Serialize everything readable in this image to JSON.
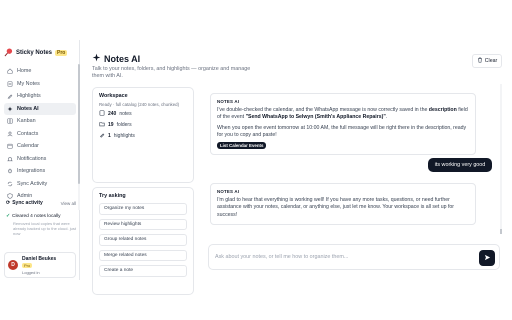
{
  "brand": {
    "name": "Sticky Notes",
    "badge": "Pro"
  },
  "sidebar": {
    "items": [
      {
        "label": "Home",
        "icon": "home-icon"
      },
      {
        "label": "My Notes",
        "icon": "note-icon"
      },
      {
        "label": "Highlights",
        "icon": "highlighter-icon"
      },
      {
        "label": "Notes AI",
        "icon": "sparkle-icon",
        "active": true
      },
      {
        "label": "Kanban",
        "icon": "kanban-icon"
      },
      {
        "label": "Contacts",
        "icon": "contacts-icon"
      },
      {
        "label": "Calendar",
        "icon": "calendar-icon"
      },
      {
        "label": "Notifications",
        "icon": "bell-icon"
      },
      {
        "label": "Integrations",
        "icon": "plug-icon"
      },
      {
        "label": "Sync Activity",
        "icon": "sync-icon"
      },
      {
        "label": "Admin",
        "icon": "shield-icon"
      }
    ]
  },
  "sync": {
    "title": "Sync activity",
    "view_all": "View all",
    "status": "Cleared 4 notes locally",
    "note": "Removed local copies that were already backed up to the cloud. just now"
  },
  "user": {
    "name": "Daniel Beukes",
    "plan": "Pro",
    "status": "Logged in",
    "initials": "D"
  },
  "header": {
    "title": "Notes AI",
    "subtitle": "Talk to your notes, folders, and highlights — organize and manage them with AI.",
    "clear_label": "Clear"
  },
  "workspace": {
    "label": "Workspace",
    "status": "Ready · full catalog (240 notes, chunked)",
    "stats": {
      "notes": "240",
      "notes_label": "notes",
      "folders": "19",
      "folders_label": "folders",
      "highlights": "1",
      "highlights_label": "highlights"
    }
  },
  "try_asking": {
    "label": "Try asking",
    "items": [
      "Organize my notes",
      "Review highlights",
      "Group related notes",
      "Merge related notes",
      "Create a note"
    ]
  },
  "chat": {
    "ai_label": "NOTES AI",
    "msg1": {
      "p1_a": "I've double-checked the calendar, and the WhatsApp message is now correctly saved in the ",
      "p1_b": "description",
      "p1_c": " field of the event ",
      "p1_d": "\"Send WhatsApp to Selwyn (Smith's Appliance Repairs)\"",
      "p1_e": ".",
      "p2": "When you open the event tomorrow at 10:00 AM, the full message will be right there in the description, ready for you to copy and paste!",
      "pill": "List Calendar Events"
    },
    "user_msg": "its working very good",
    "msg2": "I'm glad to hear that everything is working well! If you have any more tasks, questions, or need further assistance with your notes, calendar, or anything else, just let me know. Your workspace is all set up for success!"
  },
  "input": {
    "placeholder": "Ask about your notes, or tell me how to organize them..."
  }
}
